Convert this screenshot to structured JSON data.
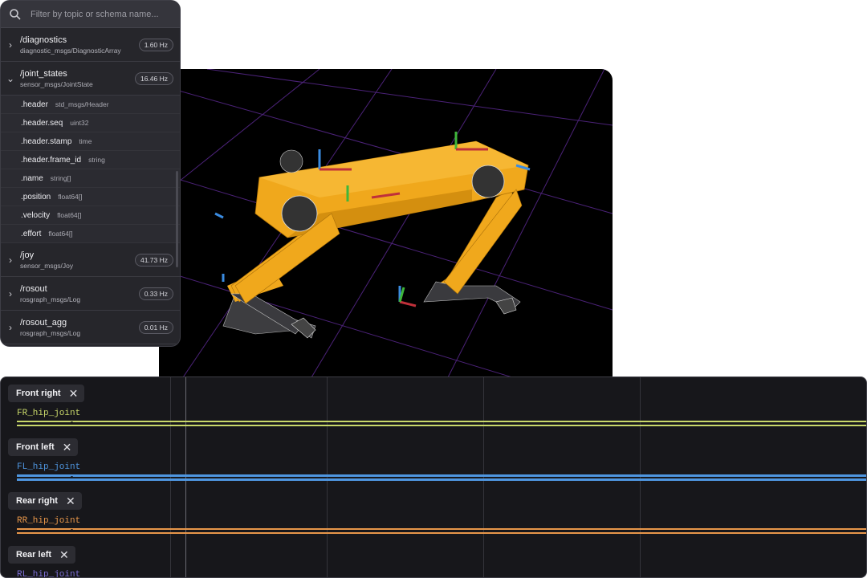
{
  "search": {
    "placeholder": "Filter by topic or schema name..."
  },
  "topics": [
    {
      "name": "/diagnostics",
      "schema": "diagnostic_msgs/DiagnosticArray",
      "hz": "1.60 Hz",
      "expanded": false
    },
    {
      "name": "/joint_states",
      "schema": "sensor_msgs/JointState",
      "hz": "16.46 Hz",
      "expanded": true
    },
    {
      "name": "/joy",
      "schema": "sensor_msgs/Joy",
      "hz": "41.73 Hz",
      "expanded": false
    },
    {
      "name": "/rosout",
      "schema": "rosgraph_msgs/Log",
      "hz": "0.33 Hz",
      "expanded": false
    },
    {
      "name": "/rosout_agg",
      "schema": "rosgraph_msgs/Log",
      "hz": "0.01 Hz",
      "expanded": false
    }
  ],
  "joint_state_fields": [
    {
      "name": ".header",
      "type": "std_msgs/Header"
    },
    {
      "name": ".header.seq",
      "type": "uint32"
    },
    {
      "name": ".header.stamp",
      "type": "time"
    },
    {
      "name": ".header.frame_id",
      "type": "string"
    },
    {
      "name": ".name",
      "type": "string[]"
    },
    {
      "name": ".position",
      "type": "float64[]"
    },
    {
      "name": ".velocity",
      "type": "float64[]"
    },
    {
      "name": ".effort",
      "type": "float64[]"
    }
  ],
  "icons": {
    "search": "search-icon",
    "expand": "chevron-right-icon",
    "collapse": "chevron-down-icon",
    "close": "close-icon"
  },
  "plots": [
    {
      "title": "Front right",
      "joint": "FR_hip_joint",
      "color": "#c9d86a"
    },
    {
      "title": "Front left",
      "joint": "FL_hip_joint",
      "color": "#4f96e0"
    },
    {
      "title": "Rear right",
      "joint": "RR_hip_joint",
      "color": "#e8974a"
    },
    {
      "title": "Rear left",
      "joint": "RL_hip_joint",
      "color": "#7d6fd6"
    }
  ],
  "colors": {
    "robot_body": "#f0a81c",
    "grid": "#5a2a88",
    "panel_bg": "#26262b",
    "plot_bg": "#17171b"
  }
}
